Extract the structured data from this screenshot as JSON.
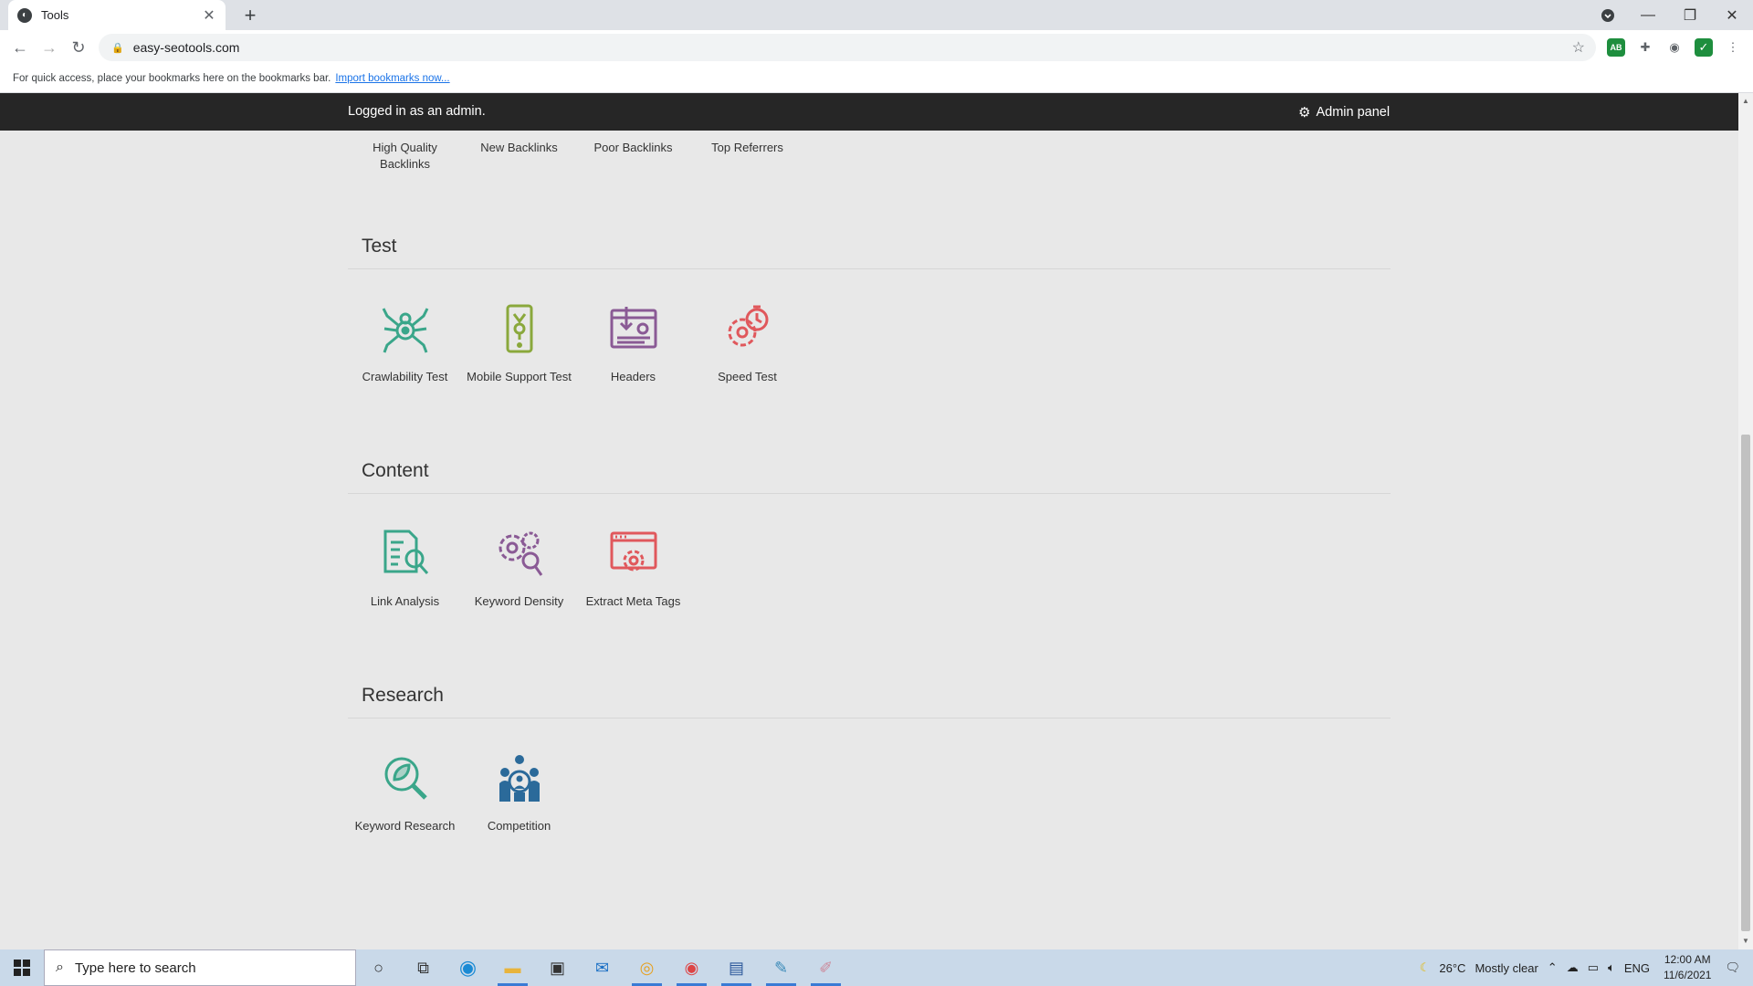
{
  "browser": {
    "tab_title": "Tools",
    "url": "easy-seotools.com",
    "bookmarks_msg": "For quick access, place your bookmarks here on the bookmarks bar.",
    "bookmarks_link": "Import bookmarks now..."
  },
  "adminbar": {
    "logged_in": "Logged in as an admin.",
    "admin_panel": "Admin panel"
  },
  "top_tools": [
    {
      "label": "High Quality Backlinks"
    },
    {
      "label": "New Backlinks"
    },
    {
      "label": "Poor Backlinks"
    },
    {
      "label": "Top Referrers"
    }
  ],
  "sections": [
    {
      "title": "Test",
      "tools": [
        {
          "label": "Crawlability Test",
          "icon": "spider-icon",
          "color": "#3aa68a"
        },
        {
          "label": "Mobile Support Test",
          "icon": "mobile-icon",
          "color": "#8aa83c"
        },
        {
          "label": "Headers",
          "icon": "headers-icon",
          "color": "#8a5a95"
        },
        {
          "label": "Speed Test",
          "icon": "speed-gear-icon",
          "color": "#e0585c"
        }
      ]
    },
    {
      "title": "Content",
      "tools": [
        {
          "label": "Link Analysis",
          "icon": "link-analysis-icon",
          "color": "#3aa68a"
        },
        {
          "label": "Keyword Density",
          "icon": "gears-search-icon",
          "color": "#8a5a95"
        },
        {
          "label": "Extract Meta Tags",
          "icon": "meta-tags-icon",
          "color": "#e0585c"
        }
      ]
    },
    {
      "title": "Research",
      "tools": [
        {
          "label": "Keyword Research",
          "icon": "leaf-search-icon",
          "color": "#3aa68a"
        },
        {
          "label": "Competition",
          "icon": "competition-icon",
          "color": "#2b6a9a"
        }
      ]
    }
  ],
  "taskbar": {
    "search_placeholder": "Type here to search",
    "weather": "26°C",
    "weather_text": "Mostly clear",
    "lang": "ENG",
    "time": "12:00 AM",
    "date": "11/6/2021"
  }
}
